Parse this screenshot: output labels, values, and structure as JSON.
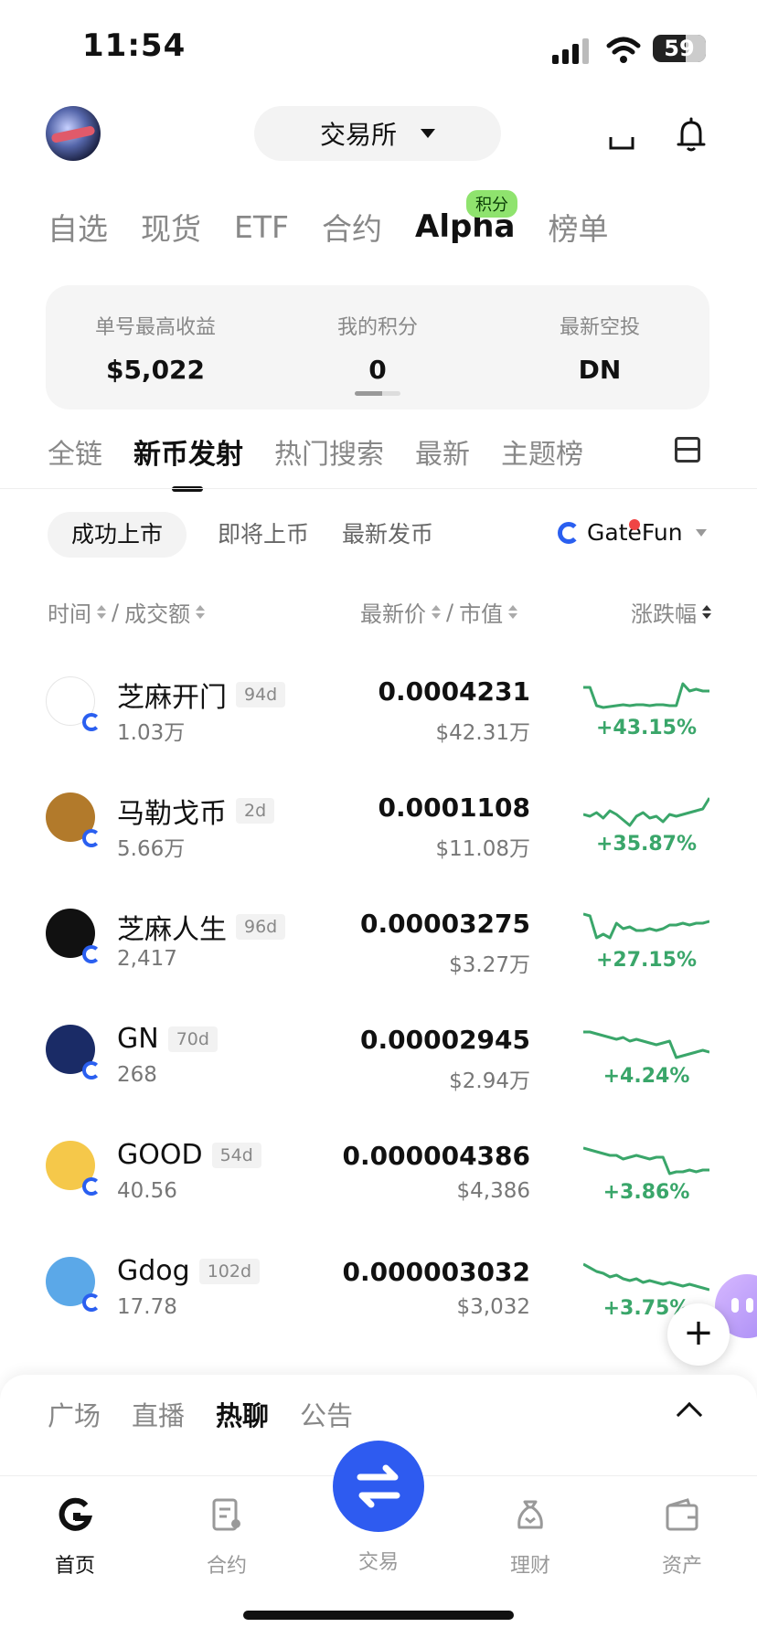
{
  "status_bar": {
    "time": "11:54",
    "battery": "59"
  },
  "header": {
    "exchange_label": "交易所"
  },
  "top_tabs": [
    {
      "label": "自选"
    },
    {
      "label": "现货"
    },
    {
      "label": "ETF"
    },
    {
      "label": "合约"
    },
    {
      "label": "Alpha",
      "badge": "积分",
      "active": true
    },
    {
      "label": "榜单"
    }
  ],
  "stats": [
    {
      "label": "单号最高收益",
      "value": "$5,022"
    },
    {
      "label": "我的积分",
      "value": "0"
    },
    {
      "label": "最新空投",
      "value": "DN"
    }
  ],
  "sub_tabs": [
    {
      "label": "全链"
    },
    {
      "label": "新币发射",
      "active": true
    },
    {
      "label": "热门搜索"
    },
    {
      "label": "最新"
    },
    {
      "label": "主题榜"
    }
  ],
  "filters": {
    "active": "成功上市",
    "upcoming": "即将上币",
    "latest": "最新发币",
    "platform": "GateFun"
  },
  "columns": {
    "time": "时间",
    "sep1": "/",
    "volume": "成交额",
    "price": "最新价",
    "sep2": "/",
    "mcap": "市值",
    "change": "涨跌幅"
  },
  "tokens": [
    {
      "name": "芝麻开门",
      "age": "94d",
      "volume": "1.03万",
      "price": "0.0004231",
      "mcap": "$42.31万",
      "change": "+43.15%",
      "spark": [
        10,
        10,
        30,
        32,
        31,
        30,
        29,
        30,
        29,
        29,
        30,
        29,
        29,
        30,
        30,
        6,
        14,
        12,
        14,
        14
      ],
      "icon_color": "#ffffff"
    },
    {
      "name": "马勒戈币",
      "age": "2d",
      "volume": "5.66万",
      "price": "0.0001108",
      "mcap": "$11.08万",
      "change": "+35.87%",
      "spark": [
        22,
        24,
        20,
        26,
        18,
        22,
        28,
        34,
        24,
        20,
        26,
        24,
        30,
        22,
        24,
        22,
        20,
        18,
        16,
        4
      ],
      "icon_color": "#b27a2b"
    },
    {
      "name": "芝麻人生",
      "age": "96d",
      "volume": "2,417",
      "price": "0.00003275",
      "mcap": "$3.27万",
      "change": "+27.15%",
      "spark": [
        4,
        6,
        30,
        26,
        30,
        14,
        20,
        18,
        22,
        22,
        20,
        22,
        20,
        16,
        16,
        14,
        16,
        14,
        14,
        12
      ],
      "icon_color": "#111111"
    },
    {
      "name": "GN",
      "age": "70d",
      "volume": "268",
      "price": "0.00002945",
      "mcap": "$2.94万",
      "change": "+4.24%",
      "spark": [
        6,
        6,
        8,
        10,
        12,
        14,
        12,
        16,
        14,
        16,
        18,
        20,
        18,
        16,
        34,
        32,
        30,
        28,
        26,
        28
      ],
      "icon_color": "#1a2b66"
    },
    {
      "name": "GOOD",
      "age": "54d",
      "volume": "40.56",
      "price": "0.000004386",
      "mcap": "$4,386",
      "change": "+3.86%",
      "spark": [
        6,
        8,
        10,
        12,
        14,
        14,
        18,
        16,
        14,
        16,
        18,
        16,
        16,
        34,
        32,
        32,
        30,
        32,
        30,
        30
      ],
      "icon_color": "#f5c84a"
    },
    {
      "name": "Gdog",
      "age": "102d",
      "volume": "17.78",
      "price": "0.000003032",
      "mcap": "$3,032",
      "change": "+3.75%",
      "spark": [
        6,
        10,
        14,
        16,
        20,
        18,
        22,
        24,
        22,
        26,
        24,
        26,
        28,
        26,
        28,
        30,
        28,
        30,
        32,
        34
      ],
      "icon_color": "#5ba8e8"
    }
  ],
  "social_tabs": [
    {
      "label": "广场"
    },
    {
      "label": "直播"
    },
    {
      "label": "热聊",
      "active": true
    },
    {
      "label": "公告"
    }
  ],
  "bottom_nav": [
    {
      "label": "首页",
      "active": true
    },
    {
      "label": "合约"
    },
    {
      "label": "交易"
    },
    {
      "label": "理财"
    },
    {
      "label": "资产"
    }
  ],
  "colors": {
    "positive": "#3aa66a",
    "accent": "#2e5bf0",
    "badge": "#8fe36e"
  }
}
